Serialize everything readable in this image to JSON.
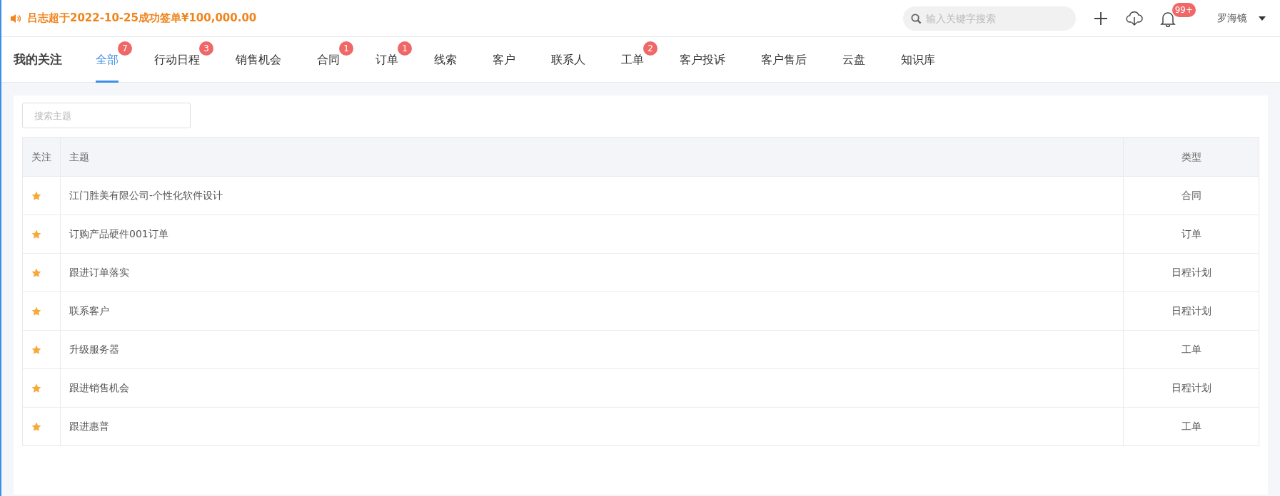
{
  "announcement": {
    "text": "吕志超于2022-10-25成功签单¥100,000.00"
  },
  "header": {
    "search": {
      "placeholder": "输入关键字搜索"
    },
    "notification_count": "99+",
    "user": "罗海镜"
  },
  "tabs_title": "我的关注",
  "tabs": [
    {
      "label": "全部",
      "selected": true,
      "badge": "7"
    },
    {
      "label": "行动日程",
      "selected": false,
      "badge": "3"
    },
    {
      "label": "销售机会",
      "selected": false
    },
    {
      "label": "合同",
      "selected": false,
      "badge": "1"
    },
    {
      "label": "订单",
      "selected": false,
      "badge": "1"
    },
    {
      "label": "线索",
      "selected": false
    },
    {
      "label": "客户",
      "selected": false
    },
    {
      "label": "联系人",
      "selected": false
    },
    {
      "label": "工单",
      "selected": false,
      "badge": "2"
    },
    {
      "label": "客户投诉",
      "selected": false
    },
    {
      "label": "客户售后",
      "selected": false
    },
    {
      "label": "云盘",
      "selected": false
    },
    {
      "label": "知识库",
      "selected": false
    }
  ],
  "search": {
    "placeholder": "搜索主题"
  },
  "table": {
    "columns": [
      "关注",
      "主题",
      "类型"
    ],
    "rows": [
      {
        "followed": true,
        "subject": "江门胜美有限公司-个性化软件设计",
        "type": "合同"
      },
      {
        "followed": true,
        "subject": "订购产品硬件001订单",
        "type": "订单"
      },
      {
        "followed": true,
        "subject": "跟进订单落实",
        "type": "日程计划"
      },
      {
        "followed": true,
        "subject": "联系客户",
        "type": "日程计划"
      },
      {
        "followed": true,
        "subject": "升级服务器",
        "type": "工单"
      },
      {
        "followed": true,
        "subject": "跟进销售机会",
        "type": "日程计划"
      },
      {
        "followed": true,
        "subject": "跟进惠普",
        "type": "工单"
      }
    ]
  }
}
